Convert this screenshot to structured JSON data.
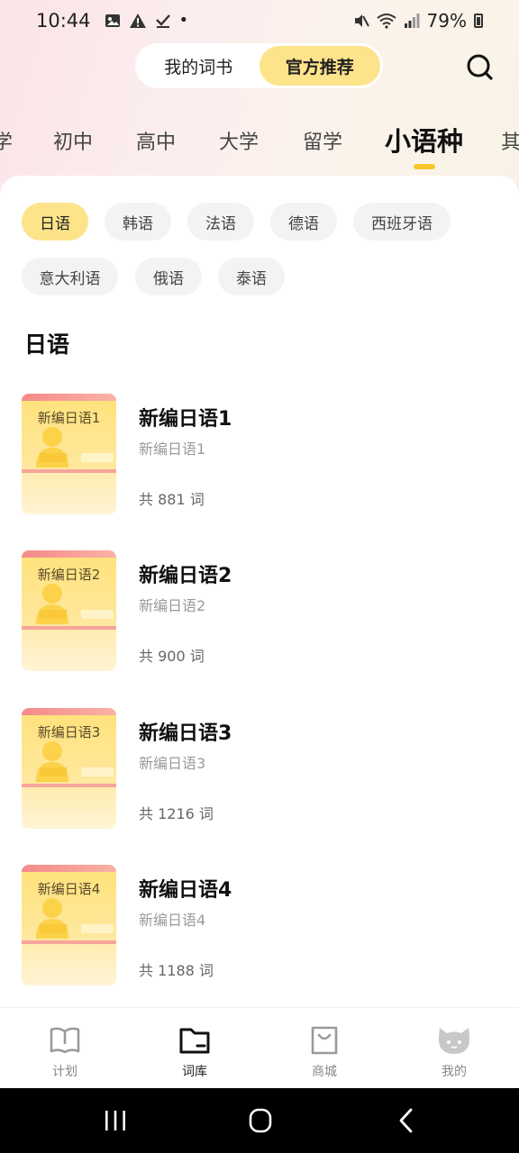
{
  "status": {
    "time": "10:44",
    "battery": "79%",
    "dot": "•"
  },
  "header": {
    "tabs": [
      {
        "label": "我的词书",
        "active": false
      },
      {
        "label": "官方推荐",
        "active": true
      }
    ]
  },
  "categories": [
    {
      "label": "学",
      "active": false
    },
    {
      "label": "初中",
      "active": false
    },
    {
      "label": "高中",
      "active": false
    },
    {
      "label": "大学",
      "active": false
    },
    {
      "label": "留学",
      "active": false
    },
    {
      "label": "小语种",
      "active": true
    },
    {
      "label": "其",
      "active": false
    }
  ],
  "languages": [
    {
      "label": "日语",
      "active": true
    },
    {
      "label": "韩语",
      "active": false
    },
    {
      "label": "法语",
      "active": false
    },
    {
      "label": "德语",
      "active": false
    },
    {
      "label": "西班牙语",
      "active": false
    },
    {
      "label": "意大利语",
      "active": false
    },
    {
      "label": "俄语",
      "active": false
    },
    {
      "label": "泰语",
      "active": false
    }
  ],
  "section_title": "日语",
  "books": [
    {
      "cover": "新编日语1",
      "title": "新编日语1",
      "subtitle": "新编日语1",
      "count": "共 881 词"
    },
    {
      "cover": "新编日语2",
      "title": "新编日语2",
      "subtitle": "新编日语2",
      "count": "共 900 词"
    },
    {
      "cover": "新编日语3",
      "title": "新编日语3",
      "subtitle": "新编日语3",
      "count": "共 1216 词"
    },
    {
      "cover": "新编日语4",
      "title": "新编日语4",
      "subtitle": "新编日语4",
      "count": "共 1188 词"
    }
  ],
  "bottom_nav": [
    {
      "label": "计划",
      "icon": "book-open-icon",
      "active": false
    },
    {
      "label": "词库",
      "icon": "folder-icon",
      "active": true
    },
    {
      "label": "商城",
      "icon": "shopping-bag-icon",
      "active": false
    },
    {
      "label": "我的",
      "icon": "cat-face-icon",
      "active": false
    }
  ],
  "colors": {
    "accent": "#fde38a",
    "indicator": "#f7c72a"
  }
}
